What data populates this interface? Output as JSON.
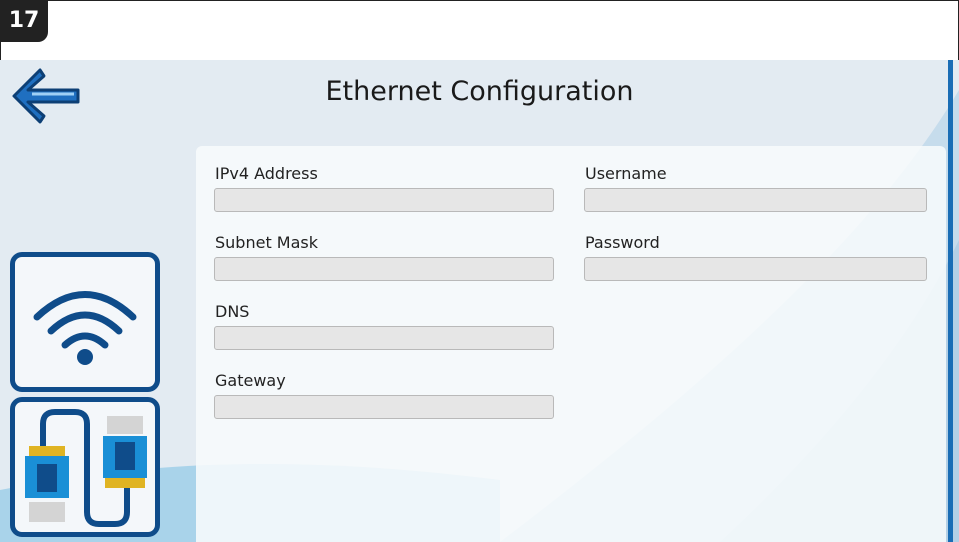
{
  "step_badge": "17",
  "header": {
    "title": "Ethernet Configuration"
  },
  "icons": {
    "back": "arrow-left-icon",
    "wifi": "wifi-icon",
    "ethernet": "ethernet-cable-icon"
  },
  "form": {
    "ipv4": {
      "label": "IPv4 Address",
      "value": ""
    },
    "subnet": {
      "label": "Subnet Mask",
      "value": ""
    },
    "dns": {
      "label": "DNS",
      "value": ""
    },
    "gateway": {
      "label": "Gateway",
      "value": ""
    },
    "username": {
      "label": "Username",
      "value": ""
    },
    "password": {
      "label": "Password",
      "value": ""
    }
  },
  "colors": {
    "accent": "#1a6db5",
    "card_border": "#0f4c8a",
    "background": "#e3ebf2"
  }
}
